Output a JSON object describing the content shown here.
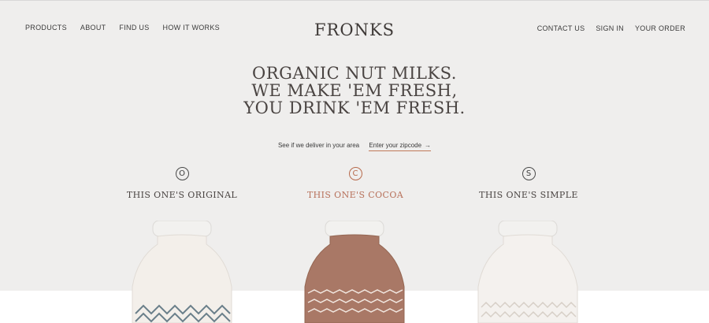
{
  "nav_left": [
    "PRODUCTS",
    "ABOUT",
    "FIND US",
    "HOW IT WORKS"
  ],
  "logo": "FRONKS",
  "nav_right": [
    "CONTACT US",
    "SIGN IN",
    "YOUR ORDER"
  ],
  "headline": [
    "ORGANIC NUT MILKS.",
    "WE MAKE 'EM FRESH,",
    "YOU DRINK 'EM FRESH."
  ],
  "delivery": {
    "prompt": "See if we deliver in your area",
    "link": "Enter your zipcode",
    "arrow": "→"
  },
  "products": [
    {
      "badge": "O",
      "name": "THIS ONE'S ORIGINAL",
      "color": "#f3efea"
    },
    {
      "badge": "C",
      "name": "THIS ONE'S COCOA",
      "color": "#a97866"
    },
    {
      "badge": "S",
      "name": "THIS ONE'S SIMPLE",
      "color": "#f4f1ee"
    }
  ],
  "colors": {
    "hero_bg": "#efeeed",
    "accent": "#b76a4c",
    "text": "#3a3a3a"
  }
}
